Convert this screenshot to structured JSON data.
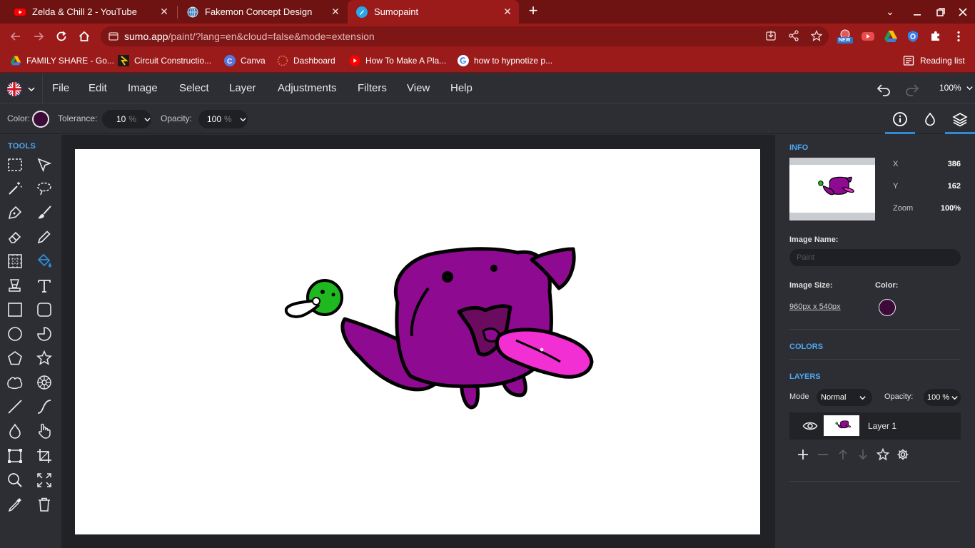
{
  "browser": {
    "tabs": [
      {
        "title": "Zelda & Chill 2 - YouTube",
        "icon": "youtube-icon",
        "active": false
      },
      {
        "title": "Fakemon Concept Design",
        "icon": "globe-icon",
        "active": false
      },
      {
        "title": "Sumopaint",
        "icon": "sumopaint-icon",
        "active": true
      }
    ],
    "url_host": "sumo.app",
    "url_rest": "/paint/?lang=en&cloud=false&mode=extension",
    "ext_new_badge": "NEW",
    "bookmarks": [
      {
        "label": "FAMILY SHARE - Go...",
        "icon": "google-drive-icon"
      },
      {
        "label": "Circuit Constructio...",
        "icon": "phet-icon"
      },
      {
        "label": "Canva",
        "icon": "canva-icon"
      },
      {
        "label": "Dashboard",
        "icon": "dashboard-icon"
      },
      {
        "label": "How To Make A Pla...",
        "icon": "youtube-icon"
      },
      {
        "label": "how to hypnotize p...",
        "icon": "google-icon"
      }
    ],
    "reading_list": "Reading list"
  },
  "menubar": {
    "items": [
      "File",
      "Edit",
      "Image",
      "Select",
      "Layer",
      "Adjustments",
      "Filters",
      "View",
      "Help"
    ],
    "zoom": "100%"
  },
  "options": {
    "color_label": "Color:",
    "tolerance_label": "Tolerance:",
    "tolerance_value": "10",
    "tolerance_unit": "%",
    "opacity_label": "Opacity:",
    "opacity_value": "100",
    "opacity_unit": "%",
    "color_hex": "#3e0a3a"
  },
  "tools": {
    "title": "TOOLS",
    "active": "paint-bucket-tool"
  },
  "info": {
    "title": "INFO",
    "x_label": "X",
    "x_value": "386",
    "y_label": "Y",
    "y_value": "162",
    "zoom_label": "Zoom",
    "zoom_value": "100%",
    "image_name_label": "Image Name:",
    "image_name_placeholder": "Paint",
    "image_size_label": "Image Size:",
    "image_size_value": "960px x 540px",
    "color_label": "Color:"
  },
  "colors": {
    "title": "COLORS"
  },
  "layers": {
    "title": "LAYERS",
    "mode_label": "Mode",
    "mode_value": "Normal",
    "opacity_label": "Opacity:",
    "opacity_value": "100 %",
    "items": [
      {
        "name": "Layer 1",
        "visible": true
      }
    ]
  },
  "colors_palette": {
    "accent": "#2f8bd6",
    "chrome_dark": "#6e1212",
    "chrome": "#9b1b1b",
    "creature_purple": "#8e0a90",
    "tongue_pink": "#f22fd2",
    "ball_green": "#1fb81f"
  }
}
